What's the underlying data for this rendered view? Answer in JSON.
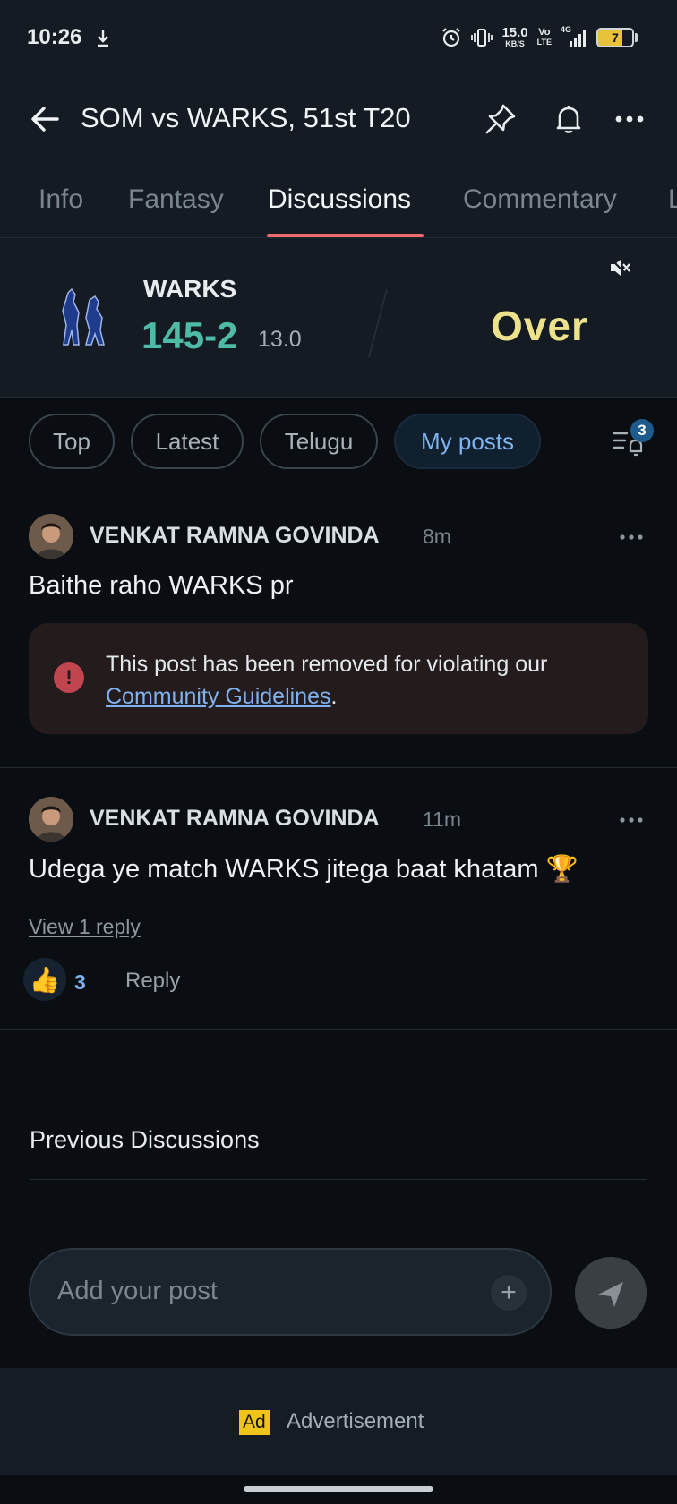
{
  "status_bar": {
    "time": "10:26",
    "net_speed_value": "15.0",
    "net_speed_unit": "KB/S",
    "volte_top": "Vo",
    "volte_bottom": "LTE",
    "network": "4G",
    "battery": "7"
  },
  "header": {
    "title": "SOM vs WARKS, 51st T20"
  },
  "tabs": [
    {
      "label": "Info"
    },
    {
      "label": "Fantasy"
    },
    {
      "label": "Discussions"
    },
    {
      "label": "Commentary"
    },
    {
      "label": "L"
    }
  ],
  "score": {
    "team": "WARKS",
    "runs": "145-2",
    "overs": "13.0",
    "status": "Over"
  },
  "filters": {
    "chips": [
      "Top",
      "Latest",
      "Telugu",
      "My posts"
    ],
    "badge": "3"
  },
  "posts": [
    {
      "author": "VENKAT RAMNA GOVINDA",
      "time": "8m",
      "text": "Baithe raho WARKS pr",
      "removed_text": "This post has been removed for violating our ",
      "guidelines_link": "Community Guidelines",
      "removed_suffix": "."
    },
    {
      "author": "VENKAT RAMNA GOVINDA",
      "time": "11m",
      "text": "Udega ye match WARKS jitega baat khatam 🏆",
      "view_reply": "View 1 reply",
      "likes": "3",
      "reply_label": "Reply"
    }
  ],
  "previous_discussions": "Previous Discussions",
  "composer": {
    "placeholder": "Add your post"
  },
  "ad": {
    "badge": "Ad",
    "label": "Advertisement"
  },
  "colors": {
    "accent_underline": "#ee6b6b",
    "score_green": "#4dbba6",
    "status_yellow": "#ece28c",
    "link_blue": "#7fb2ee"
  }
}
